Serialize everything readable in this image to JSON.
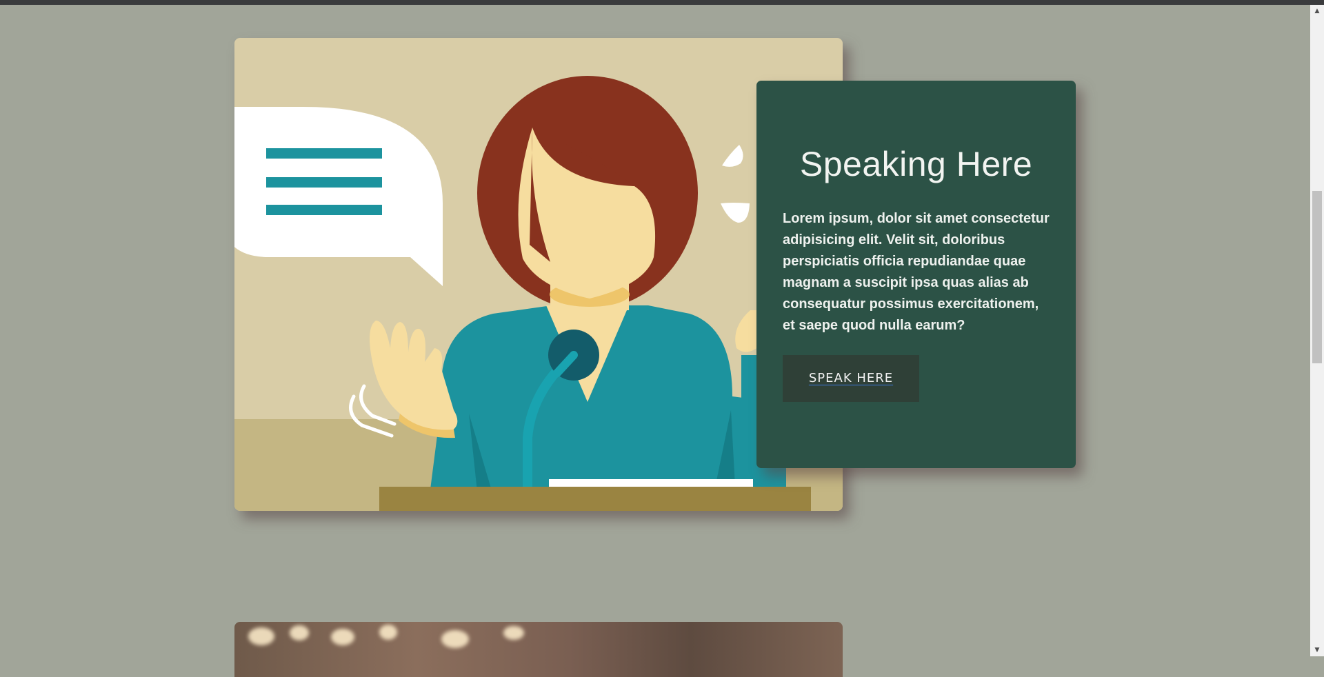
{
  "card": {
    "title": "Speaking Here",
    "description": "Lorem ipsum, dolor sit amet consectetur adipisicing elit. Velit sit, doloribus perspiciatis officia repudiandae quae magnam a suscipit ipsa quas alias ab consequatur possimus exercitationem, et saepe quod nulla earum?",
    "button_label": "SPEAK HERE"
  },
  "images": {
    "feature_icon": "speaker-at-podium-illustration",
    "next_icon": "portrait-photo"
  },
  "colors": {
    "page_background": "#a1a599",
    "card_background": "#2c5246",
    "button_background": "#2f4037",
    "accent_teal": "#1c939e"
  }
}
